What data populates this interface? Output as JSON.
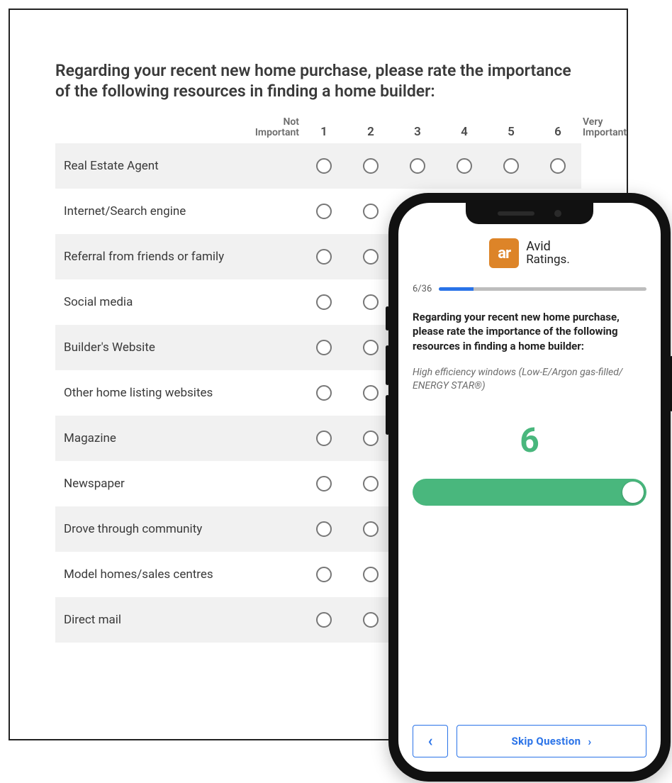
{
  "desktop": {
    "question": "Regarding your recent new home purchase, please rate the importance of the following resources in finding a home builder:",
    "left_caption_line1": "Not",
    "left_caption_line2": "Important",
    "right_caption_line1": "Very",
    "right_caption_line2": "Important",
    "scale": [
      "1",
      "2",
      "3",
      "4",
      "5",
      "6"
    ],
    "rows": [
      "Real Estate Agent",
      "Internet/Search engine",
      "Referral from friends or family",
      "Social media",
      "Builder's Website",
      "Other home listing websites",
      "Magazine",
      "Newspaper",
      "Drove through community",
      "Model homes/sales centres",
      "Direct mail"
    ]
  },
  "mobile": {
    "brand_line1": "Avid",
    "brand_line2": "Ratings.",
    "progress_label": "6/36",
    "progress_percent": 16.6,
    "question_title": "Regarding your recent new home purchase, please rate the importance of the following resources in finding a home builder:",
    "question_sub": "High efficiency windows (Low-E/Argon gas-filled/ ENERGY STAR®)",
    "value": "6",
    "skip_label": "Skip Question",
    "back_glyph": "‹",
    "skip_glyph": "›"
  }
}
